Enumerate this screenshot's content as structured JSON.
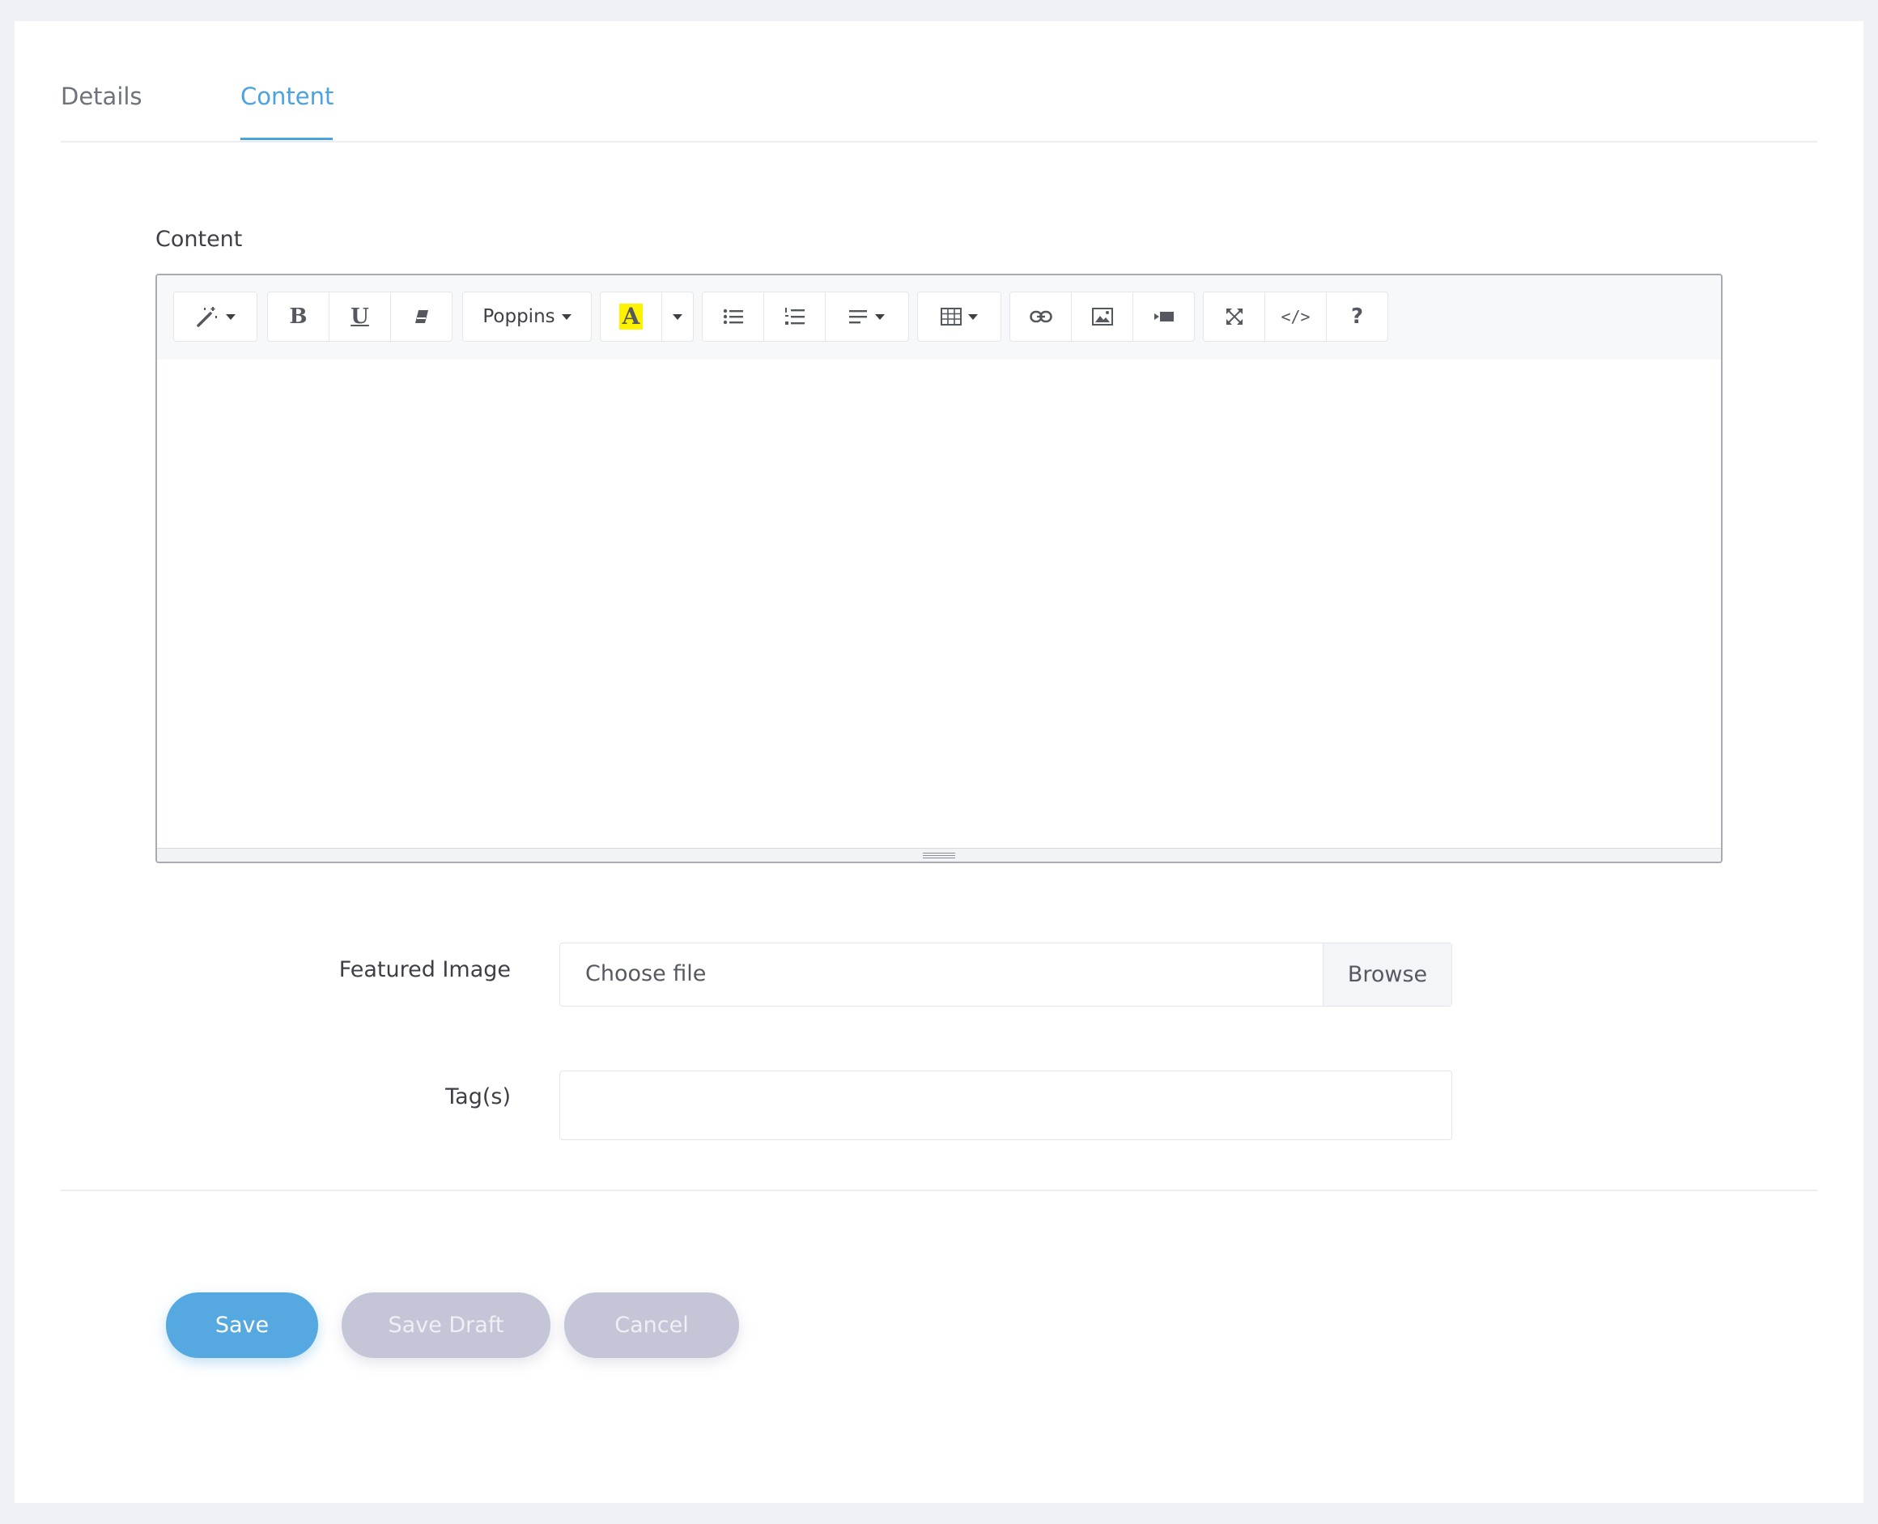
{
  "tabs": [
    {
      "label": "Details",
      "active": false
    },
    {
      "label": "Content",
      "active": true
    }
  ],
  "editor": {
    "label": "Content",
    "font": "Poppins",
    "toolbar_icons": [
      "magic-wand-icon",
      "bold-icon",
      "underline-icon",
      "eraser-icon",
      "font-family-select",
      "highlight-color-icon",
      "color-dropdown-icon",
      "unordered-list-icon",
      "ordered-list-icon",
      "align-icon",
      "table-icon",
      "link-icon",
      "picture-icon",
      "video-icon",
      "fullscreen-icon",
      "code-view-icon",
      "help-icon"
    ],
    "body": ""
  },
  "featured_image": {
    "label": "Featured Image",
    "placeholder": "Choose file",
    "browse_label": "Browse"
  },
  "tags": {
    "label": "Tag(s)",
    "value": ""
  },
  "actions": {
    "save": "Save",
    "save_draft": "Save Draft",
    "cancel": "Cancel"
  },
  "colors": {
    "accent": "#4aa3df",
    "save_button": "#56a9e0",
    "secondary_button": "#c4c5d6",
    "highlight": "#fff200"
  }
}
